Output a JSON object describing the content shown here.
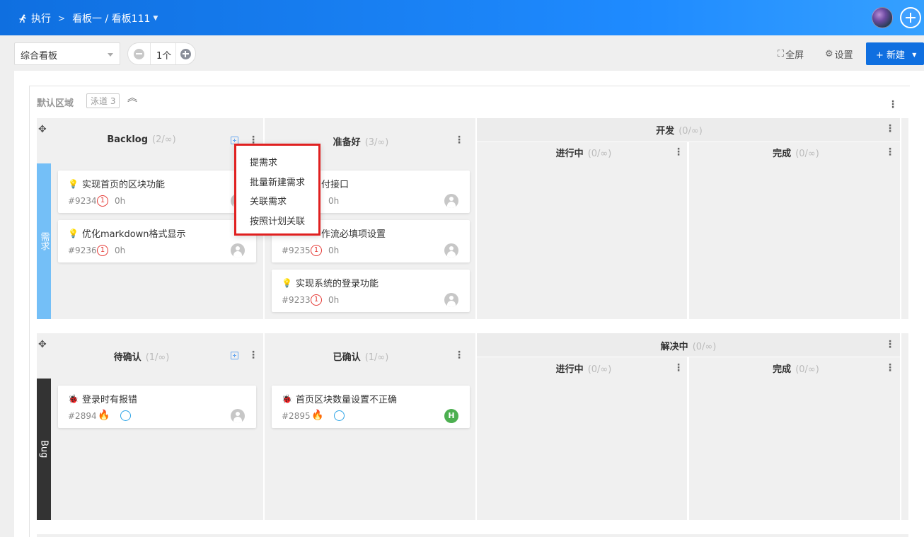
{
  "breadcrumb": {
    "root": "执行",
    "current": "看板一 / 看板111"
  },
  "toolbar": {
    "board_select": "综合看板",
    "count_value": "1个",
    "fullscreen": "全屏",
    "settings": "设置",
    "new_button": "新建"
  },
  "region": {
    "title": "默认区域",
    "lane_tag": "泳道 3"
  },
  "lanes": [
    {
      "name": "需求",
      "color": "#74bff7",
      "columns": [
        {
          "title": "Backlog",
          "limit": "(2/∞)"
        },
        {
          "title": "准备好",
          "limit": "(3/∞)"
        },
        {
          "title": "开发",
          "limit": "(0/∞)",
          "subcolumns": [
            {
              "title": "进行中",
              "limit": "(0/∞)"
            },
            {
              "title": "完成",
              "limit": "(0/∞)"
            }
          ]
        }
      ],
      "cards": [
        {
          "title": "实现首页的区块功能",
          "id": "#9234",
          "priority": "1",
          "hours": "0h"
        },
        {
          "title": "优化markdown格式显示",
          "id": "#9236",
          "priority": "1",
          "hours": "0h"
        },
        {
          "title": "付接口",
          "id": "",
          "priority": "",
          "hours": "0h"
        },
        {
          "title": "作流必填项设置",
          "id": "#9235",
          "priority": "1",
          "hours": "0h"
        },
        {
          "title": "实现系统的登录功能",
          "id": "#9233",
          "priority": "1",
          "hours": "0h"
        }
      ]
    },
    {
      "name": "Bug",
      "color": "#333333",
      "columns": [
        {
          "title": "待确认",
          "limit": "(1/∞)"
        },
        {
          "title": "已确认",
          "limit": "(1/∞)"
        },
        {
          "title": "解决中",
          "limit": "(0/∞)",
          "subcolumns": [
            {
              "title": "进行中",
              "limit": "(0/∞)"
            },
            {
              "title": "完成",
              "limit": "(0/∞)"
            }
          ]
        }
      ],
      "cards": [
        {
          "title": "登录时有报错",
          "id": "#2894",
          "severity": "3"
        },
        {
          "title": "首页区块数量设置不正确",
          "id": "#2895",
          "severity": "3",
          "assignee": "H"
        }
      ]
    }
  ],
  "menu": {
    "items": [
      "提需求",
      "批量新建需求",
      "关联需求",
      "按照计划关联"
    ]
  },
  "colors": {
    "primary": "#0f6fe0",
    "priority": "#e53935",
    "menu_highlight": "#e02020"
  }
}
